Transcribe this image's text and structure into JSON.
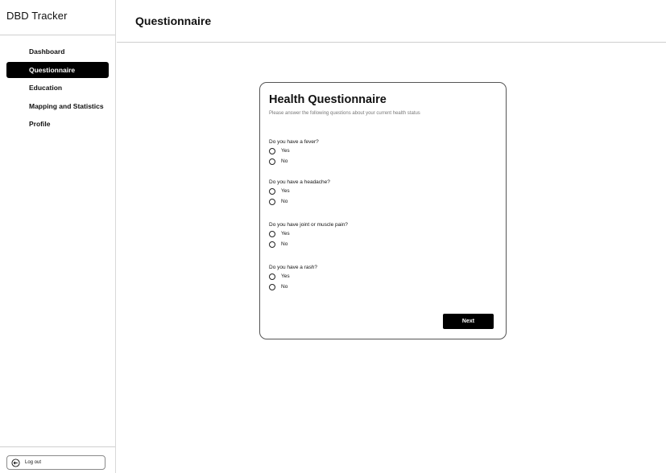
{
  "app": {
    "title": "DBD Tracker"
  },
  "sidebar": {
    "items": [
      {
        "label": "Dashboard",
        "active": false
      },
      {
        "label": "Questionnaire",
        "active": true
      },
      {
        "label": "Education",
        "active": false
      },
      {
        "label": "Mapping and Statistics",
        "active": false
      },
      {
        "label": "Profile",
        "active": false
      }
    ],
    "logout_label": "Log out",
    "logout_icon": "logout-icon"
  },
  "header": {
    "title": "Questionnaire"
  },
  "questionnaire": {
    "title": "Health Questionnaire",
    "subtitle": "Please answer the following questions about your current health status",
    "questions": [
      {
        "text": "Do you have a fever?",
        "options": [
          "Yes",
          "No"
        ]
      },
      {
        "text": "Do you have a headache?",
        "options": [
          "Yes",
          "No"
        ]
      },
      {
        "text": "Do you have joint or muscle pain?",
        "options": [
          "Yes",
          "No"
        ]
      },
      {
        "text": "Do you have a rash?",
        "options": [
          "Yes",
          "No"
        ]
      }
    ],
    "next_label": "Next"
  },
  "colors": {
    "accent": "#000000",
    "border": "#cfcfcf"
  }
}
